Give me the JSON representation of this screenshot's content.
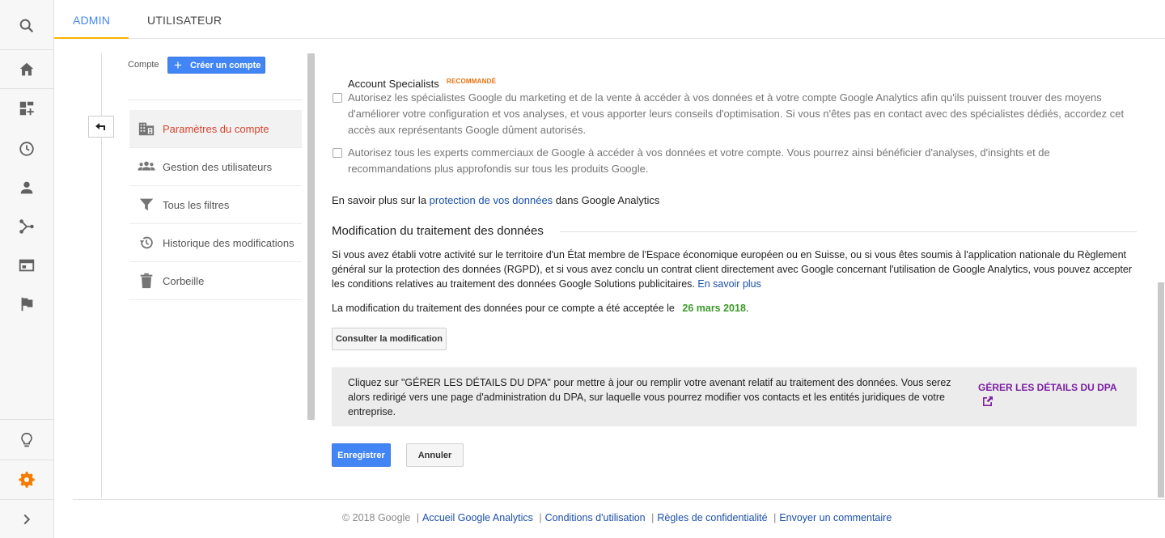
{
  "tabs": {
    "admin": "ADMIN",
    "user": "UTILISATEUR"
  },
  "nav": {
    "account_label": "Compte",
    "create_account": "Créer un compte",
    "items": [
      {
        "label": "Paramètres du compte",
        "icon": "building-icon",
        "active": true
      },
      {
        "label": "Gestion des utilisateurs",
        "icon": "people-icon",
        "active": false
      },
      {
        "label": "Tous les filtres",
        "icon": "filter-icon",
        "active": false
      },
      {
        "label": "Historique des modifications",
        "icon": "history-icon",
        "active": false
      },
      {
        "label": "Corbeille",
        "icon": "trash-icon",
        "active": false
      }
    ]
  },
  "content": {
    "specialists_title": "Account Specialists",
    "recommended_badge": "RECOMMANDÉ",
    "checkbox1": "Autorisez les spécialistes Google du marketing et de la vente à accéder à vos données et à votre compte Google Analytics afin qu'ils puissent trouver des moyens d'améliorer votre configuration et vos analyses, et vous apporter leurs conseils d'optimisation. Si vous n'êtes pas en contact avec des spécialistes dédiés, accordez cet accès aux représentants Google dûment autorisés.",
    "checkbox2": "Autorisez tous les experts commerciaux de Google à accéder à vos données et votre compte. Vous pourrez ainsi bénéficier d'analyses, d'insights et de recommandations plus approfondis sur tous les produits Google.",
    "learn_prefix": "En savoir plus sur la ",
    "learn_link": "protection de vos données",
    "learn_suffix": " dans Google Analytics",
    "section_title": "Modification du traitement des données",
    "paragraph": "Si vous avez établi votre activité sur le territoire d'un État membre de l'Espace économique européen ou en Suisse, ou si vous êtes soumis à l'application nationale du Règlement général sur la protection des données (RGPD), et si vous avez conclu un contrat client directement avec Google concernant l'utilisation de Google Analytics, vous pouvez accepter les conditions relatives au traitement des données Google Solutions publicitaires.",
    "paragraph_link": "En savoir plus",
    "accepted_text": "La modification du traitement des données pour ce compte a été acceptée le",
    "accepted_date": "26 mars 2018",
    "accepted_end": ".",
    "consult_button": "Consulter la modification",
    "dpa_text": "Cliquez sur \"GÉRER LES DÉTAILS DU DPA\" pour mettre à jour ou remplir votre avenant relatif au traitement des données. Vous serez alors redirigé vers une page d'administration du DPA, sur laquelle vous pourrez modifier vos contacts et les entités juridiques de votre entreprise.",
    "dpa_link": "GÉRER LES DÉTAILS DU DPA",
    "save_button": "Enregistrer",
    "cancel_button": "Annuler"
  },
  "footer": {
    "copyright": "© 2018 Google",
    "links": [
      "Accueil Google Analytics",
      "Conditions d'utilisation",
      "Règles de confidentialité",
      "Envoyer un commentaire"
    ],
    "separator": "|"
  },
  "colors": {
    "accent": "#4285f4",
    "active_nav": "#d9432f",
    "tab_underline": "#ffb300",
    "date": "#3a9a28",
    "dpa_link": "#7b1fa2",
    "gear": "#f57c00"
  }
}
